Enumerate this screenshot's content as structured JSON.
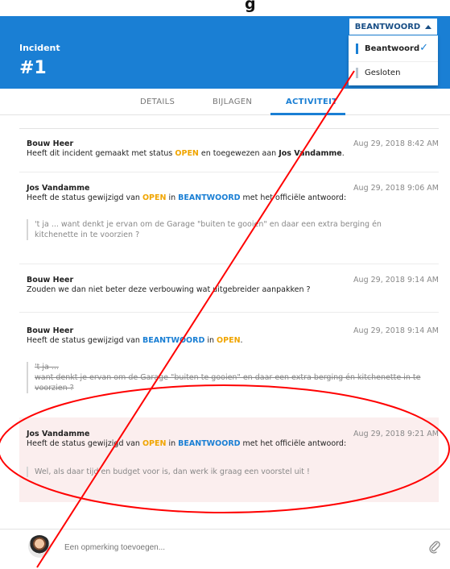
{
  "page": {
    "top_cut_text": "g",
    "incident_label": "Incident",
    "incident_number": "#1"
  },
  "status": {
    "current": "BEANTWOORD",
    "options": [
      {
        "label": "Beantwoord",
        "selected": true
      },
      {
        "label": "Gesloten",
        "selected": false
      }
    ]
  },
  "tabs": [
    {
      "label": "DETAILS",
      "active": false
    },
    {
      "label": "BIJLAGEN",
      "active": false
    },
    {
      "label": "ACTIVITEIT",
      "active": true
    }
  ],
  "entries": [
    {
      "author": "Bouw Heer",
      "time": "Aug 29, 2018 8:42 AM",
      "line": {
        "p1": "Heeft dit incident gemaakt met status ",
        "s1": "OPEN",
        "p2": " en toegewezen aan ",
        "name": "Jos Vandamme",
        "p3": "."
      }
    },
    {
      "author": "Jos Vandamme",
      "time": "Aug 29, 2018 9:06 AM",
      "line": {
        "p1": "Heeft de status gewijzigd van ",
        "s1": "OPEN",
        "p2": " in ",
        "s2": "BEANTWOORD",
        "p3": " met het officiële antwoord:"
      },
      "quote_l1": "'t ja ... want denkt je ervan om de Garage \"buiten te gooien\" en daar een extra berging én",
      "quote_l2": "kitchenette in te voorzien ?"
    },
    {
      "author": "Bouw Heer",
      "time": "Aug 29, 2018 9:14 AM",
      "text": "Zouden we dan niet beter deze verbouwing wat uitgebreider aanpakken ?"
    },
    {
      "author": "Bouw Heer",
      "time": "Aug 29, 2018 9:14 AM",
      "line": {
        "p1": "Heeft de status gewijzigd van ",
        "s1": "BEANTWOORD",
        "p2": " in ",
        "s2": "OPEN",
        "p3": "."
      },
      "quote_l1": "'t ja ...",
      "quote_l2": "want denkt je ervan om de Garage \"buiten te gooien\" en daar een extra berging én kitchenette in te",
      "quote_l3": "voorzien ?"
    },
    {
      "author": "Jos Vandamme",
      "time": "Aug 29, 2018 9:21 AM",
      "line": {
        "p1": "Heeft de status gewijzigd van ",
        "s1": "OPEN",
        "p2": " in ",
        "s2": "BEANTWOORD",
        "p3": " met het officiële antwoord:"
      },
      "quote_l1": "Wel, als daar tijd en budget voor is, dan werk ik graag een voorstel uit !"
    }
  ],
  "comment": {
    "placeholder": "Een opmerking toevoegen..."
  },
  "icons": {
    "check": "check-icon",
    "caret": "caret-up-icon",
    "attach": "paperclip-icon"
  },
  "colors": {
    "header_blue": "#1a7fd4",
    "status_open": "#f0a500",
    "status_answered": "#1a7fd4",
    "annotation_red": "#ff0000",
    "highlight_fill": "#fbeeee"
  }
}
